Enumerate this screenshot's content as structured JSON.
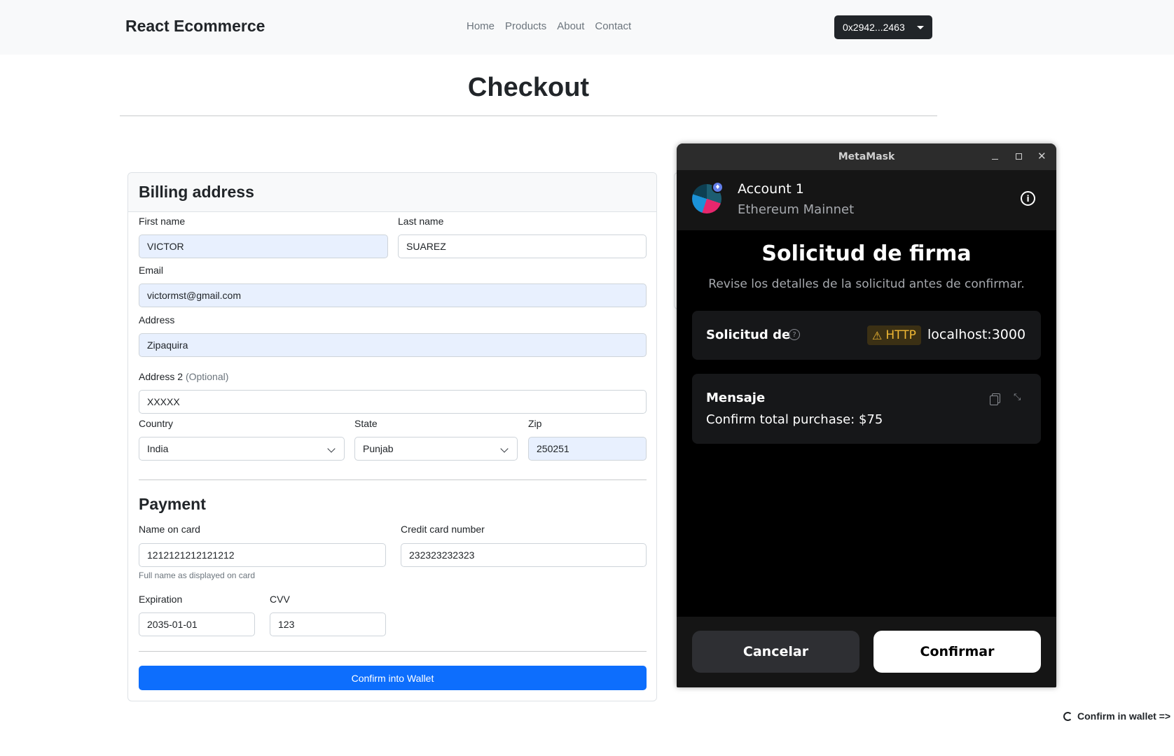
{
  "navbar": {
    "brand": "React Ecommerce",
    "links": [
      "Home",
      "Products",
      "About",
      "Contact"
    ],
    "wallet_address": "0x2942...2463"
  },
  "page": {
    "title": "Checkout"
  },
  "billing": {
    "title": "Billing address",
    "first_name": {
      "label": "First name",
      "value": "VICTOR"
    },
    "last_name": {
      "label": "Last name",
      "value": "SUAREZ"
    },
    "email": {
      "label": "Email",
      "value": "victormst@gmail.com"
    },
    "address": {
      "label": "Address",
      "value": "Zipaquira"
    },
    "address2": {
      "label": "Address 2",
      "optional": "(Optional)",
      "value": "XXXXX"
    },
    "country": {
      "label": "Country",
      "value": "India"
    },
    "state": {
      "label": "State",
      "value": "Punjab"
    },
    "zip": {
      "label": "Zip",
      "value": "250251"
    }
  },
  "payment": {
    "title": "Payment",
    "name_on_card": {
      "label": "Name on card",
      "value": "1212121212121212",
      "help": "Full name as displayed on card"
    },
    "card_number": {
      "label": "Credit card number",
      "value": "232323232323"
    },
    "expiration": {
      "label": "Expiration",
      "value": "2035-01-01"
    },
    "cvv": {
      "label": "CVV",
      "value": "123"
    },
    "submit_label": "Confirm into Wallet"
  },
  "metamask": {
    "window_title": "MetaMask",
    "account_name": "Account 1",
    "network": "Ethereum Mainnet",
    "heading": "Solicitud de firma",
    "subheading": "Revise los detalles de la solicitud antes de confirmar.",
    "request_from_label": "Solicitud de",
    "http_badge": "HTTP",
    "host": "localhost:3000",
    "message_label": "Mensaje",
    "message": "Confirm total purchase: $75",
    "cancel_label": "Cancelar",
    "confirm_label": "Confirmar"
  },
  "status": {
    "text": "Confirm in wallet =>"
  },
  "colors": {
    "primary_button": "#0d6efd",
    "autofill": "#e8f0fe",
    "mm_background": "#000000",
    "http_warning": "#f0b834"
  }
}
